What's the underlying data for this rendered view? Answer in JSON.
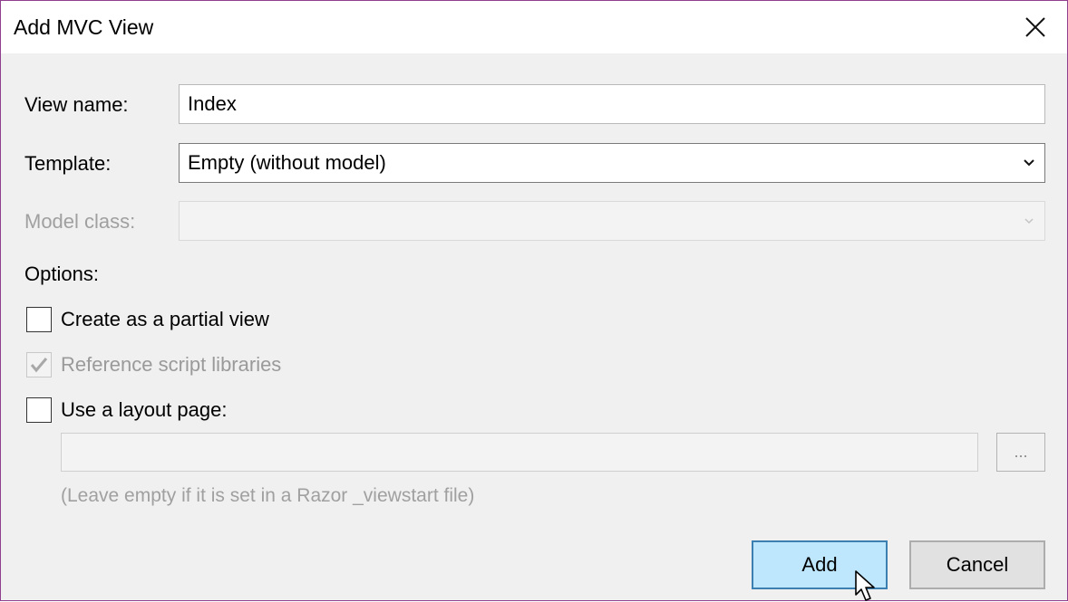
{
  "dialog": {
    "title": "Add MVC View"
  },
  "form": {
    "view_name_label": "View name:",
    "view_name_value": "Index",
    "template_label": "Template:",
    "template_value": "Empty (without model)",
    "model_class_label": "Model class:",
    "model_class_value": "",
    "options_label": "Options:"
  },
  "options": {
    "partial_view": {
      "label": "Create as a partial view",
      "checked": false,
      "enabled": true
    },
    "script_libraries": {
      "label": "Reference script libraries",
      "checked": true,
      "enabled": false
    },
    "layout_page": {
      "label": "Use a layout page:",
      "checked": false,
      "enabled": true
    }
  },
  "layout": {
    "path_value": "",
    "browse_label": "...",
    "hint": "(Leave empty if it is set in a Razor _viewstart file)"
  },
  "buttons": {
    "add_label": "Add",
    "cancel_label": "Cancel"
  },
  "colors": {
    "window_border": "#8e3f8e",
    "add_button_fill": "#bee6fd",
    "add_button_border": "#3c7fb1"
  }
}
